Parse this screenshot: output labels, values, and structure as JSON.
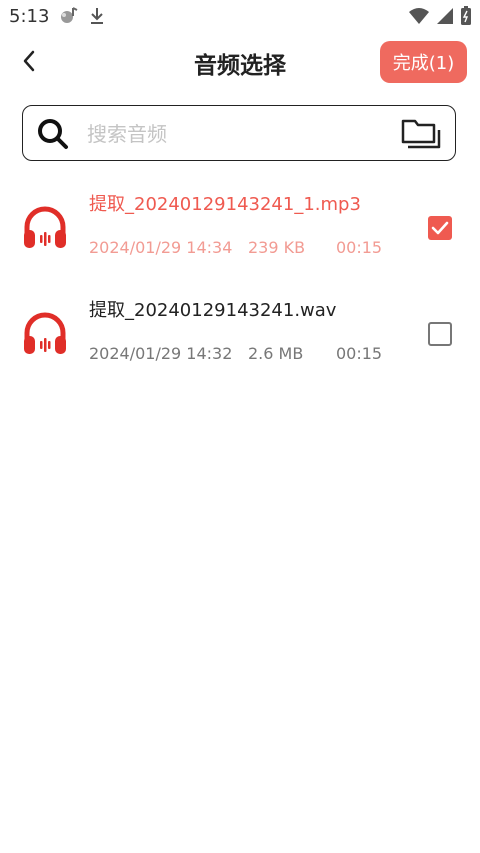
{
  "status_bar": {
    "time": "5:13"
  },
  "header": {
    "title": "音频选择",
    "done_label": "完成(1)"
  },
  "search": {
    "placeholder": "搜索音频",
    "value": ""
  },
  "files": [
    {
      "name": "提取_20240129143241_1.mp3",
      "date": "2024/01/29 14:34",
      "size": "239 KB",
      "duration": "00:15",
      "checked": true
    },
    {
      "name": "提取_20240129143241.wav",
      "date": "2024/01/29 14:32",
      "size": "2.6 MB",
      "duration": "00:15",
      "checked": false
    }
  ],
  "colors": {
    "accent": "#ef5a50",
    "button": "#ef6a5f",
    "meta_selected": "#f29b93",
    "meta_unselected": "#777777"
  },
  "icons": [
    "notification-icon",
    "download-icon",
    "wifi-icon",
    "signal-icon",
    "battery-icon",
    "back-arrow-icon",
    "search-icon",
    "folder-icon",
    "headphones-icon",
    "checkbox-icon"
  ]
}
